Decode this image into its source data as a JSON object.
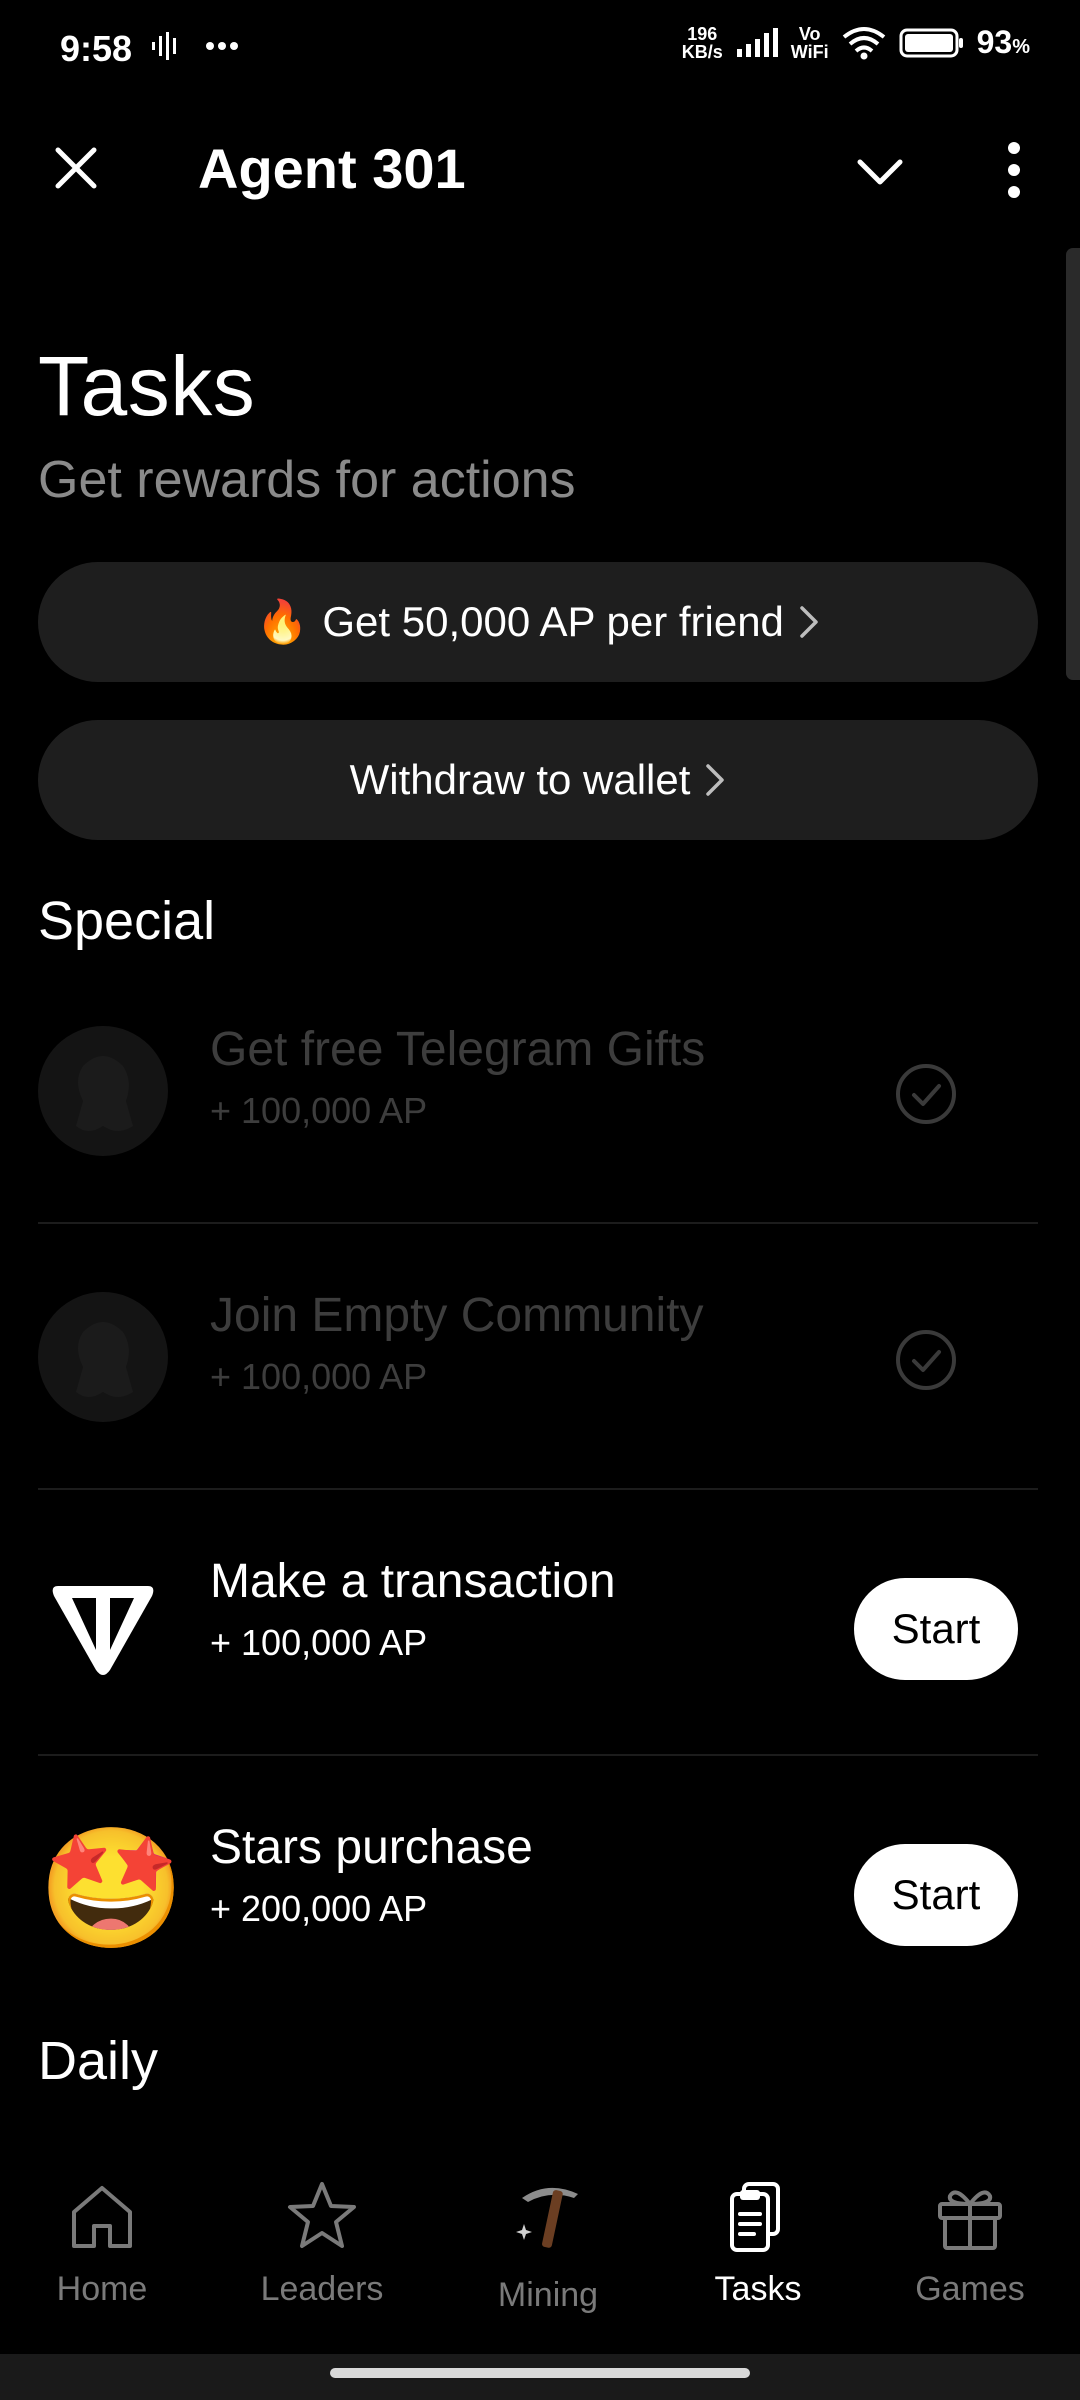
{
  "status_bar": {
    "time": "9:58",
    "net_speed_value": "196",
    "net_speed_unit": "KB/s",
    "vowifi_top": "Vo",
    "vowifi_bottom": "WiFi",
    "battery_percent": "93",
    "battery_symbol": "%"
  },
  "header": {
    "title": "Agent 301"
  },
  "page": {
    "title": "Tasks",
    "subtitle": "Get rewards for actions"
  },
  "promo": {
    "friend_emoji": "🔥",
    "friend_label": "Get 50,000 AP per friend",
    "withdraw_label": "Withdraw to wallet"
  },
  "sections": {
    "special": "Special",
    "daily": "Daily"
  },
  "tasks": [
    {
      "title": "Get free Telegram Gifts",
      "reward": "+ 100,000 AP",
      "state": "done"
    },
    {
      "title": "Join Empty Community",
      "reward": "+ 100,000 AP",
      "state": "done"
    },
    {
      "title": "Make a transaction",
      "reward": "+ 100,000 AP",
      "state": "start",
      "button": "Start",
      "icon_emoji": ""
    },
    {
      "title": "Stars purchase",
      "reward": "+ 200,000 AP",
      "state": "start",
      "button": "Start",
      "icon_emoji": "🤩"
    }
  ],
  "nav": [
    {
      "label": "Home",
      "icon": "home-icon"
    },
    {
      "label": "Leaders",
      "icon": "star-icon"
    },
    {
      "label": "Mining",
      "icon": "pickaxe-icon"
    },
    {
      "label": "Tasks",
      "icon": "clipboard-icon",
      "active": true
    },
    {
      "label": "Games",
      "icon": "gift-icon"
    }
  ]
}
